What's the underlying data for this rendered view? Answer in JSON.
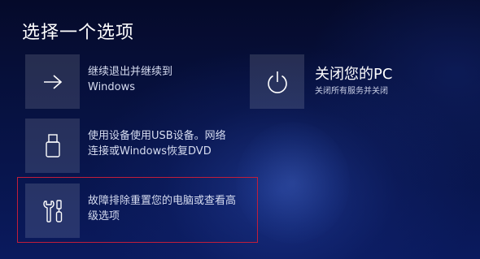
{
  "header": {
    "title": "选择一个选项"
  },
  "options": [
    {
      "id": "continue",
      "icon": "arrow-right-icon",
      "label": "继续退出并继续到Windows"
    },
    {
      "id": "use-device",
      "icon": "usb-drive-icon",
      "label": "使用设备使用USB设备。网络连接或Windows恢复DVD"
    },
    {
      "id": "troubleshoot",
      "icon": "tools-icon",
      "label": "故障排除重置您的电脑或查看高级选项"
    },
    {
      "id": "shutdown",
      "icon": "power-icon",
      "title": "关闭您的PC",
      "subtitle": "关闭所有服务并关闭"
    }
  ],
  "colors": {
    "highlight_border": "#c21d3a",
    "background_dark": "#050a2a",
    "background_blue": "#0a1a5e"
  }
}
